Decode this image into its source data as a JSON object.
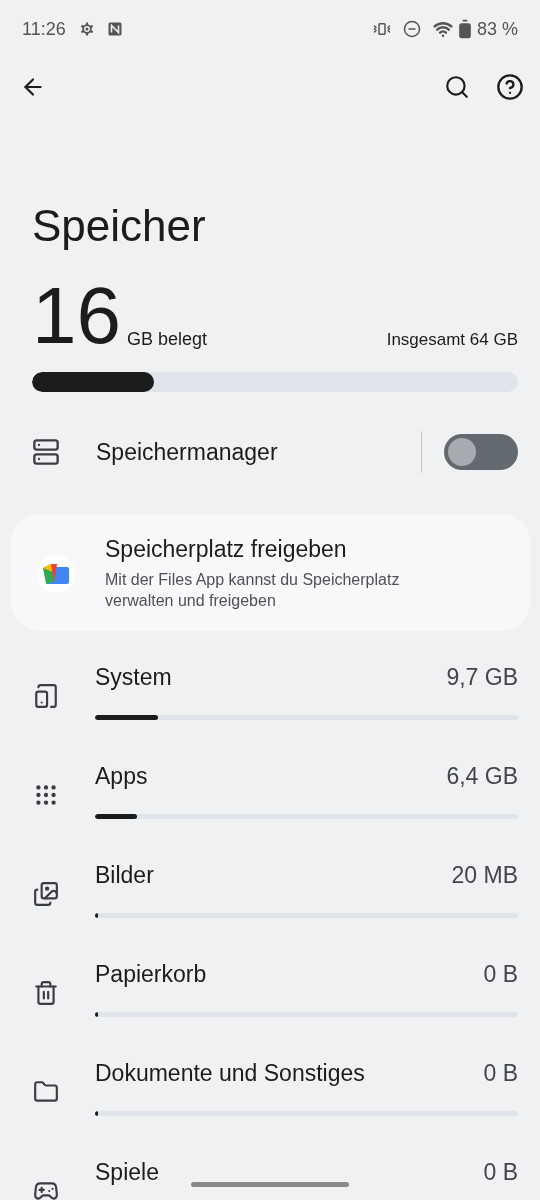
{
  "status_bar": {
    "time": "11:26",
    "battery": "83 %"
  },
  "title": "Speicher",
  "usage": {
    "amount": "16",
    "unit": "GB belegt",
    "total": "Insgesamt 64 GB",
    "level": 0.25
  },
  "manager": {
    "label": "Speichermanager",
    "on": false
  },
  "card": {
    "title": "Speicherplatz freigeben",
    "text": "Mit der Files App kannst du Speicherplatz verwalten und freigeben"
  },
  "categories": [
    {
      "name": "System",
      "size": "9,7 GB",
      "level": 0.15
    },
    {
      "name": "Apps",
      "size": "6,4 GB",
      "level": 0.1
    },
    {
      "name": "Bilder",
      "size": "20 MB",
      "level": 0
    },
    {
      "name": "Papierkorb",
      "size": "0 B",
      "level": 0
    },
    {
      "name": "Dokumente und Sonstiges",
      "size": "0 B",
      "level": 0
    },
    {
      "name": "Spiele",
      "size": "0 B"
    }
  ]
}
